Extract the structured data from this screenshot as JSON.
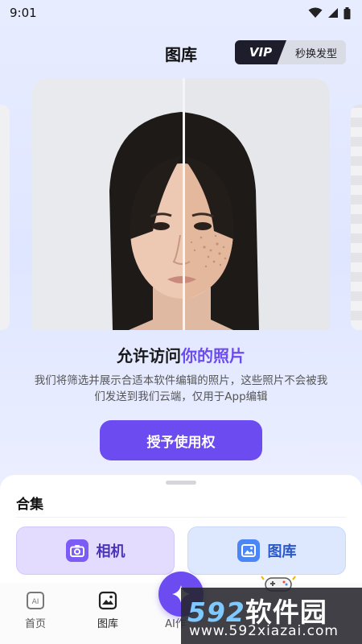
{
  "status_bar": {
    "time": "9:01"
  },
  "header": {
    "title": "图库",
    "vip_tag": "VIP",
    "vip_text": "秒换发型"
  },
  "permission": {
    "title_part1": "允许访问",
    "title_part2": "你的照片",
    "description": "我们将筛选并展示合适本软件编辑的照片，这些照片不会被我们发送到我们云端，仅用于App编辑",
    "grant_button": "授予使用权"
  },
  "sheet": {
    "title": "合集",
    "options": [
      {
        "label": "相机",
        "icon": "camera-icon"
      },
      {
        "label": "图库",
        "icon": "image-icon"
      }
    ]
  },
  "tabbar": {
    "tabs": [
      {
        "label": "首页",
        "icon": "ai-box-icon"
      },
      {
        "label": "图库",
        "icon": "gallery-icon"
      },
      {
        "label": "AI作",
        "icon": "sparkle-icon"
      }
    ]
  },
  "watermark": {
    "brand_num": "592",
    "brand_cn": "软件园",
    "url": "www.592xiazai.com"
  },
  "colors": {
    "accent": "#6c4cf0",
    "camera_bg": "#e4dcff",
    "gallery_bg": "#dde8ff"
  }
}
